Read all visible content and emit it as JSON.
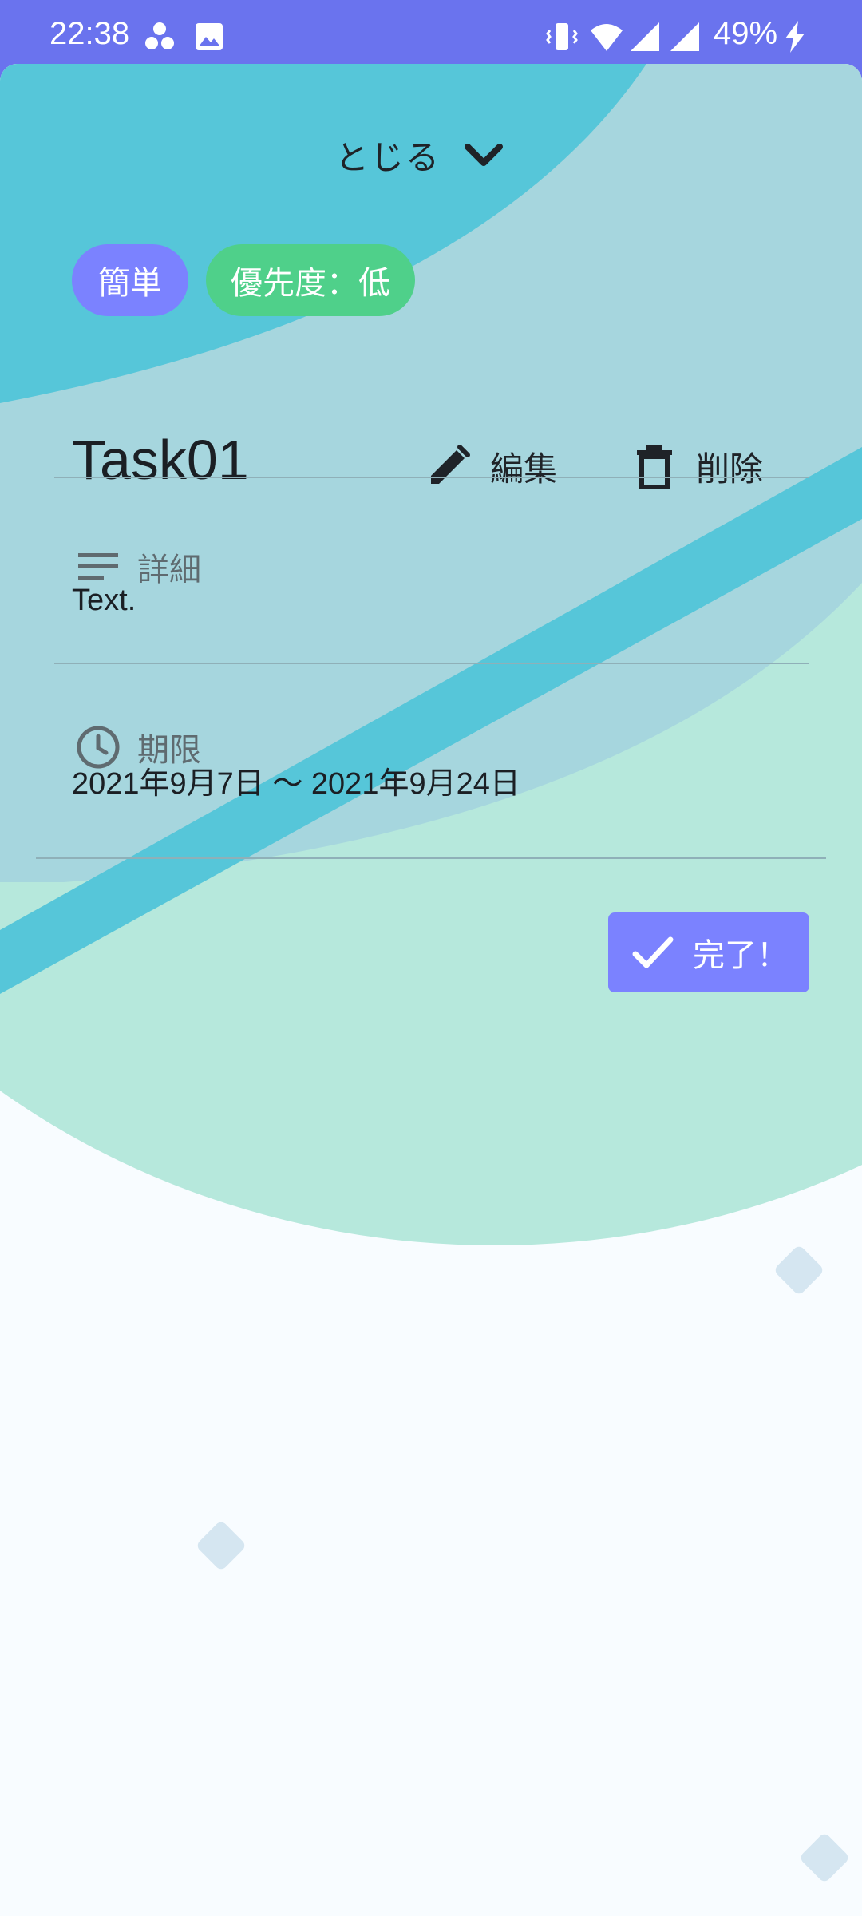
{
  "status_bar": {
    "time": "22:38",
    "battery_percent": "49%",
    "icons": [
      "app-cluster-icon",
      "image-icon",
      "vibrate-icon",
      "wifi-icon",
      "signal-icon",
      "signal-icon",
      "charging-icon"
    ]
  },
  "sheet": {
    "close_label": "とじる",
    "chips": {
      "difficulty": "簡単",
      "priority": "優先度：低"
    },
    "task_title": "Task01",
    "actions": {
      "edit_label": "編集",
      "delete_label": "削除"
    },
    "details": {
      "label": "詳細",
      "text": "Text."
    },
    "deadline": {
      "label": "期限",
      "value": "2021年9月7日 〜 2021年9月24日"
    },
    "complete_label": "完了！"
  },
  "colors": {
    "status_bar": "#6a73ee",
    "accent": "#7b82ff",
    "priority_low": "#4fd08a",
    "teal": "#56c6d9",
    "teal_light": "#a6d6de",
    "mint": "#b6e8dc",
    "background": "#f8fcff"
  }
}
